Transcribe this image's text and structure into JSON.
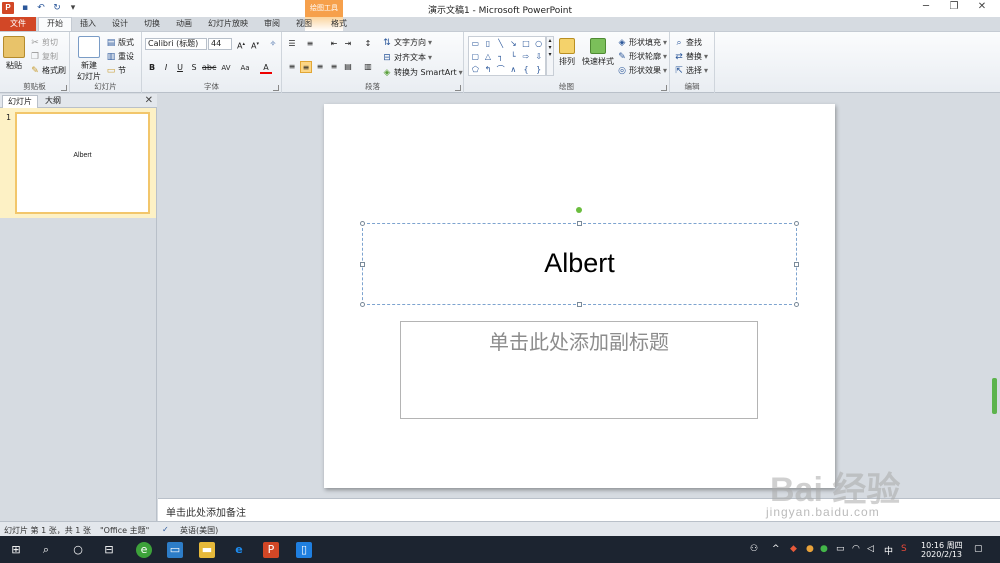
{
  "window": {
    "title": "演示文稿1 - Microsoft PowerPoint",
    "app_icon": "P",
    "contextual_group": "绘图工具"
  },
  "tabs": [
    "文件",
    "开始",
    "插入",
    "设计",
    "切换",
    "动画",
    "幻灯片放映",
    "审阅",
    "视图",
    "格式"
  ],
  "ribbon": {
    "clipboard": {
      "paste": "粘贴",
      "cut": "剪切",
      "copy": "复制",
      "format_painter": "格式刷",
      "label": "剪贴板"
    },
    "slides": {
      "new_slide_line1": "新建",
      "new_slide_line2": "幻灯片",
      "layout": "版式",
      "reset": "重设",
      "section": "节",
      "label": "幻灯片"
    },
    "font": {
      "name": "Calibri (标题)",
      "size": "44",
      "label": "字体"
    },
    "paragraph": {
      "text_direction": "文字方向",
      "align_text": "对齐文本",
      "convert_smartart": "转换为 SmartArt",
      "label": "段落"
    },
    "drawing": {
      "arrange": "排列",
      "quick_styles": "快速样式",
      "shape_fill": "形状填充",
      "shape_outline": "形状轮廓",
      "shape_effects": "形状效果",
      "label": "绘图"
    },
    "editing": {
      "find": "查找",
      "replace": "替换",
      "select": "选择",
      "label": "编辑"
    }
  },
  "left_pane": {
    "tab_slides": "幻灯片",
    "tab_outline": "大纲",
    "slide_number": "1",
    "thumb_title": "Albert"
  },
  "slide": {
    "title": "Albert",
    "subtitle_placeholder": "单击此处添加副标题"
  },
  "notes": {
    "placeholder": "单击此处添加备注"
  },
  "status": {
    "slide_info": "幻灯片 第 1 张，共 1 张",
    "theme": "\"Office 主题\"",
    "language": "英语(美国)"
  },
  "watermark": {
    "main": "Bai 经验",
    "sub": "jingyan.baidu.com"
  },
  "taskbar": {
    "time": "10:16 周四",
    "date": "2020/2/13",
    "ime": "中"
  },
  "colors": {
    "accent": "#d24726",
    "ribbon_bg": "#fbfcfd",
    "taskbar": "#1c2430",
    "selection": "#f2c66b"
  }
}
